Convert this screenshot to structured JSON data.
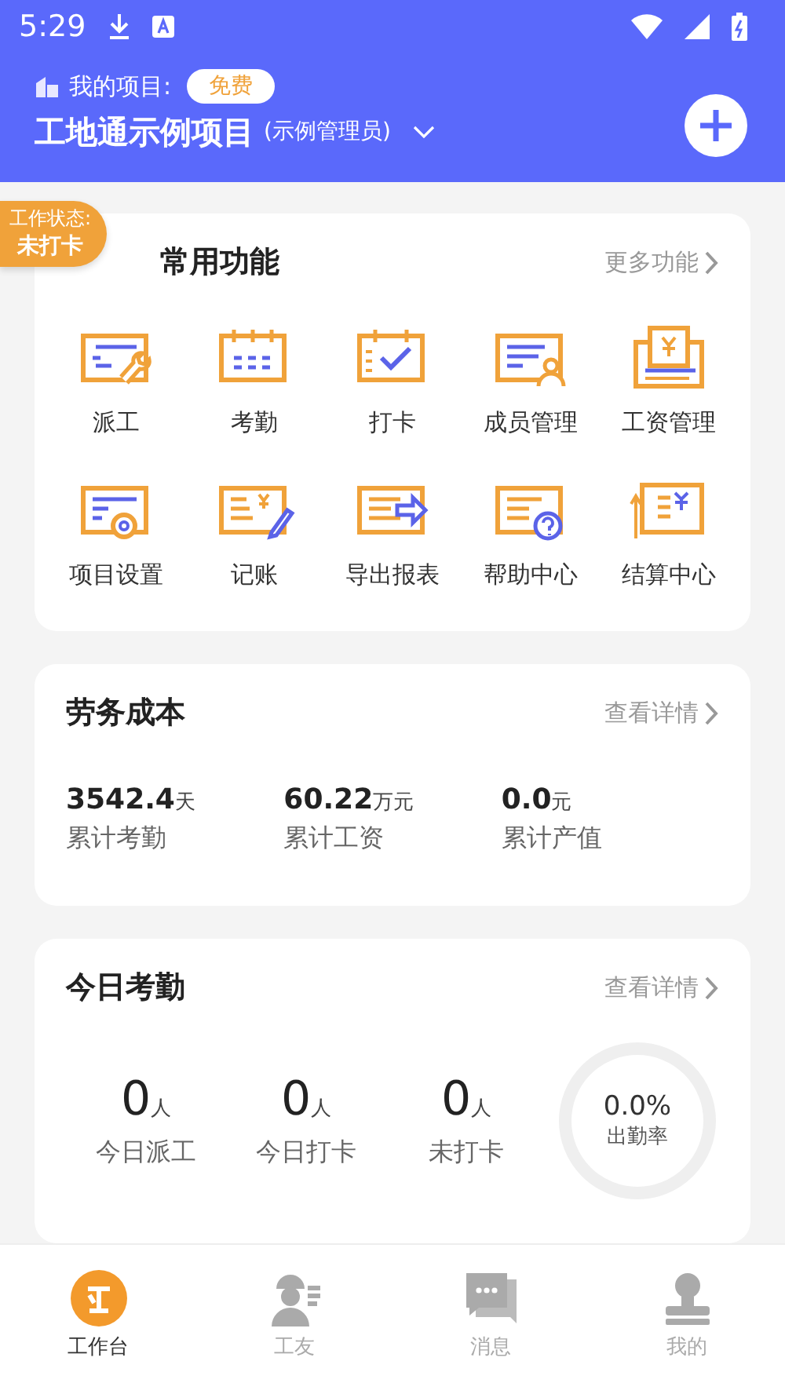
{
  "status_bar": {
    "time": "5:29"
  },
  "header": {
    "project_label": "我的项目:",
    "plan_badge": "免费",
    "project_name": "工地通示例项目",
    "role": "(示例管理员)"
  },
  "work_status": {
    "label": "工作状态:",
    "value": "未打卡"
  },
  "common_functions": {
    "title": "常用功能",
    "more": "更多功能",
    "items": [
      {
        "label": "派工"
      },
      {
        "label": "考勤"
      },
      {
        "label": "打卡"
      },
      {
        "label": "成员管理"
      },
      {
        "label": "工资管理"
      },
      {
        "label": "项目设置"
      },
      {
        "label": "记账"
      },
      {
        "label": "导出报表"
      },
      {
        "label": "帮助中心"
      },
      {
        "label": "结算中心"
      }
    ]
  },
  "labor_cost": {
    "title": "劳务成本",
    "more": "查看详情",
    "stats": [
      {
        "value": "3542.4",
        "unit": "天",
        "label": "累计考勤"
      },
      {
        "value": "60.22",
        "unit": "万元",
        "label": "累计工资"
      },
      {
        "value": "0.0",
        "unit": "元",
        "label": "累计产值"
      }
    ]
  },
  "today_attendance": {
    "title": "今日考勤",
    "more": "查看详情",
    "stats": [
      {
        "value": "0",
        "unit": "人",
        "label": "今日派工"
      },
      {
        "value": "0",
        "unit": "人",
        "label": "今日打卡"
      },
      {
        "value": "0",
        "unit": "人",
        "label": "未打卡"
      }
    ],
    "rate": {
      "value": "0.0%",
      "label": "出勤率"
    }
  },
  "tab_bar": [
    {
      "label": "工作台",
      "selected": true
    },
    {
      "label": "工友",
      "selected": false
    },
    {
      "label": "消息",
      "selected": false
    },
    {
      "label": "我的",
      "selected": false
    }
  ]
}
